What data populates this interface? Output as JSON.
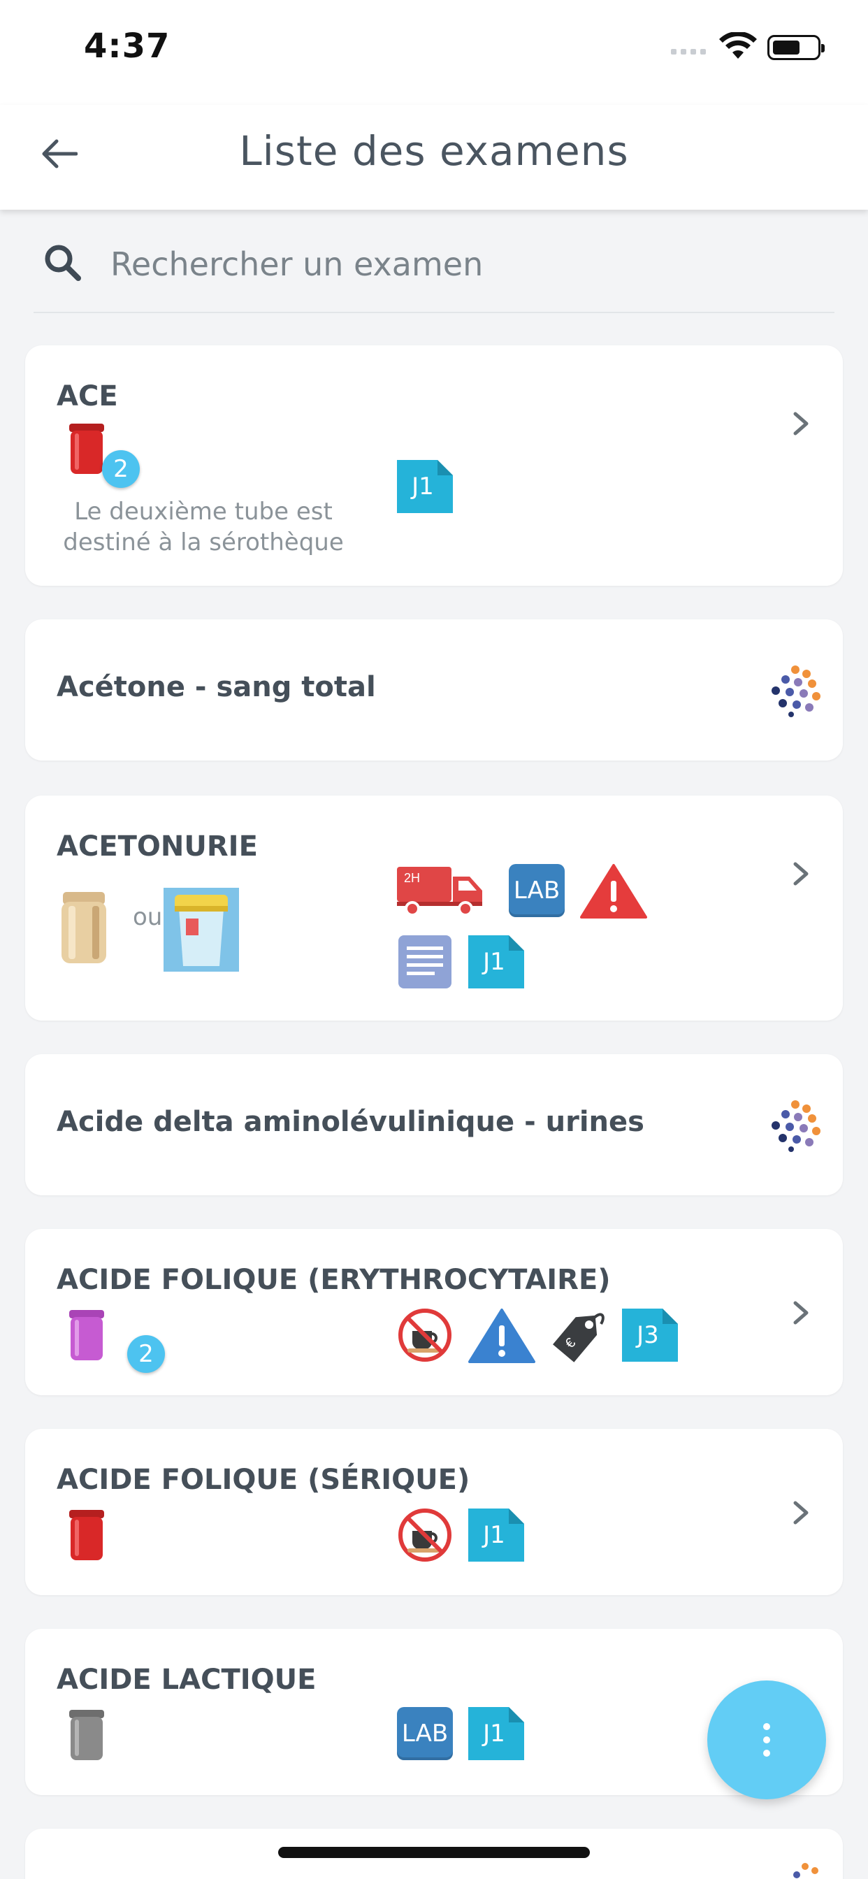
{
  "status_bar": {
    "time": "4:37"
  },
  "header": {
    "title": "Liste des examens"
  },
  "search": {
    "placeholder": "Rechercher un examen"
  },
  "colors": {
    "accent": "#4dc3f0",
    "fab": "#62cdf5",
    "lab_blue": "#3a82bf",
    "jday": "#25b3d9",
    "warning_red": "#e53c3c",
    "tube_red": "#d92828",
    "tube_purple": "#c65bd2",
    "tube_gray": "#8a8a8a"
  },
  "exams": [
    {
      "name": "ACE",
      "tube": "red-tube",
      "tube_count": "2",
      "note": "Le deuxième tube est destiné à la sérothèque",
      "delay": "J1",
      "has_chevron": true
    },
    {
      "name": "Acétone - sang total",
      "external_lab": true
    },
    {
      "name": "ACETONURIE",
      "containers": [
        "beige-tube",
        "urine-cup"
      ],
      "or_label": "ou",
      "transport": "2H",
      "lab_label": "LAB",
      "warning": true,
      "document": true,
      "delay": "J1",
      "has_chevron": true
    },
    {
      "name": "Acide delta aminolévulinique - urines",
      "external_lab": true
    },
    {
      "name": "ACIDE FOLIQUE (ERYTHROCYTAIRE)",
      "tube": "purple-tube",
      "tube_count": "2",
      "fasting": true,
      "warning": true,
      "price_tag": true,
      "delay": "J3",
      "has_chevron": true
    },
    {
      "name": "ACIDE FOLIQUE (SÉRIQUE)",
      "tube": "red-tube",
      "fasting": true,
      "delay": "J1",
      "has_chevron": true
    },
    {
      "name": "ACIDE LACTIQUE",
      "tube": "gray-tube",
      "lab_label": "LAB",
      "delay": "J1"
    }
  ]
}
